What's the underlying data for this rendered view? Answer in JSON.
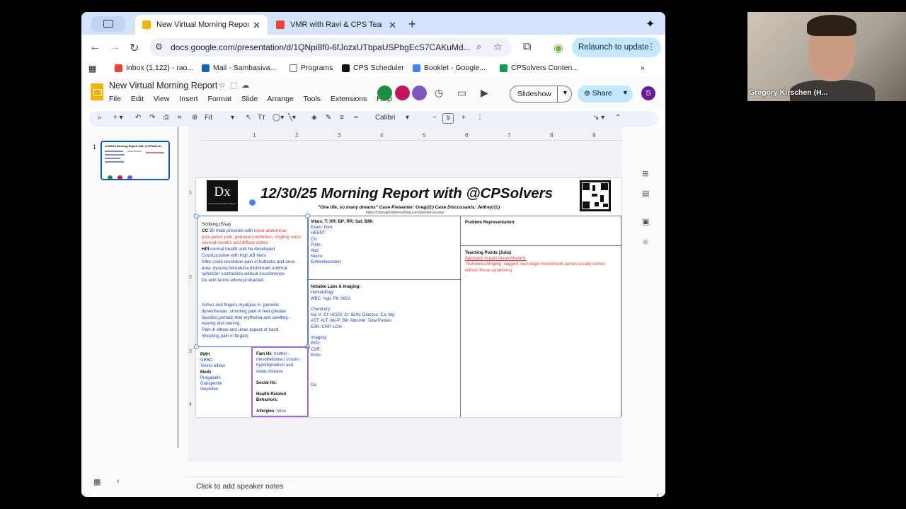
{
  "browser": {
    "tabs": [
      {
        "title": "New Virtual Morning Report -",
        "active": true
      },
      {
        "title": "VMR with Ravi & CPS Team A",
        "active": false
      }
    ],
    "url": "docs.google.com/presentation/d/1QNpi8f0-6fJozxUTbpaUSPbgEcS7CAKuMd...",
    "relaunch_label": "Relaunch to update",
    "bookmarks": [
      "Inbox (1,122) - rao...",
      "Mail - Sambasiva...",
      "Programs",
      "CPS Scheduler",
      "Booklet - Google...",
      "CPSolvers Conten..."
    ]
  },
  "doc": {
    "title": "New Virtual Morning Report",
    "menus": [
      "File",
      "Edit",
      "View",
      "Insert",
      "Format",
      "Slide",
      "Arrange",
      "Tools",
      "Extensions",
      "Help"
    ],
    "slideshow_label": "Slideshow",
    "share_label": "Share",
    "avatar_initial": "S",
    "zoom": "Fit",
    "font": "Calibri",
    "font_size": "9",
    "speaker_notes_placeholder": "Click to add speaker notes",
    "slide_number": "1"
  },
  "slide": {
    "logo": "Dx",
    "title": "12/30/25 Morning Report with @CPSolvers",
    "subtitle": "\"One life, so many dreams\"    Case Presenter: Greg(@)  Case Discussants: Jeffrey(@)",
    "link": "https://clinicalproblemsolving.com/present-a-case/",
    "scribe": {
      "header": "Scribing (Siva)",
      "cc_label": "CC",
      "cc_text": ":30 male presents with ",
      "cc_red": "lower abdominal pain,pelvic pain, perianal  numbness, tingling since several months and diffuse aches",
      "hpi_label": "HPI",
      "hpi_text": ":normal health until he developed Covid,positive with high AB titers",
      "line2": "After covid resolution pain in buttocks and anus area ,dysuria,hematuria,midstream urethral sphincter contraction without incontinence",
      "line3": " Dx  with tennis elbow,protracted",
      "line4": "Aches and fingers,myalgias in ,periodic dysesthesias ,shooting pain in feet (plantar fasciitis),perodic feet erythema and swelling -waxing and waning.",
      "line5": "Pain in elbow and ulnar aspect of hand",
      "line6": "Shooting pain in fingers"
    },
    "pmh": {
      "label": "PMH",
      "items": [
        "GERD",
        "Tennis elbow"
      ],
      "meds_label": "Meds",
      "meds": [
        "Pregabalin",
        "Gabapentin",
        "Ibuprofen"
      ]
    },
    "famhx": {
      "label": "Fam Hx",
      "text": ": mother - mesothelioma / cousin - hypothyroidism and celiac disease",
      "social": "Social Hx:",
      "health": "Health-Related Behaviors:",
      "allergies_label": "Allergies",
      "allergies": ": none"
    },
    "vitals": {
      "line1": "Vitals: T:   HR:   BP:   RR:   Sat:   BMI:",
      "exam": "Exam:  Gen:",
      "heent": "HEENT:",
      "cv": "CV:",
      "pulm": "Pulm:",
      "abd": "Abd:",
      "neuro": "Neuro:",
      "ext": "Extremities/skin:"
    },
    "labs": {
      "header": "Notable Labs & Imaging:",
      "heme": "Hematology:",
      "heme_vals": "WBC:   Hgb:   Plt:   MCV:",
      "chem": "Chemistry:",
      "chem1": "Na:   K:   Cl:   HCO3:   Cr:   BUN:   Glucose:   Ca:   Mg:",
      "chem2": "AST:   ALT:   Alk-P:   Bili:   Albumin:   Total Protein:",
      "chem3": "ESR:   CRP:   LDH:",
      "imaging": "Imaging:",
      "ekg": "EKG:",
      "cxr": "CXR:",
      "echo": "Echo:",
      "dx": "Dx:"
    },
    "problem_rep": "Problem Representation:",
    "teaching": {
      "header": "Teaching Points (Julia)",
      "link": "Approach to pain (neuro/rheum):",
      "point": "-Numbness/tingling: suggest neurologic involvement (aches usually comes without those symptoms)",
      "dash": "-"
    }
  },
  "video": {
    "name": "Gregory Kirschen (H..."
  }
}
